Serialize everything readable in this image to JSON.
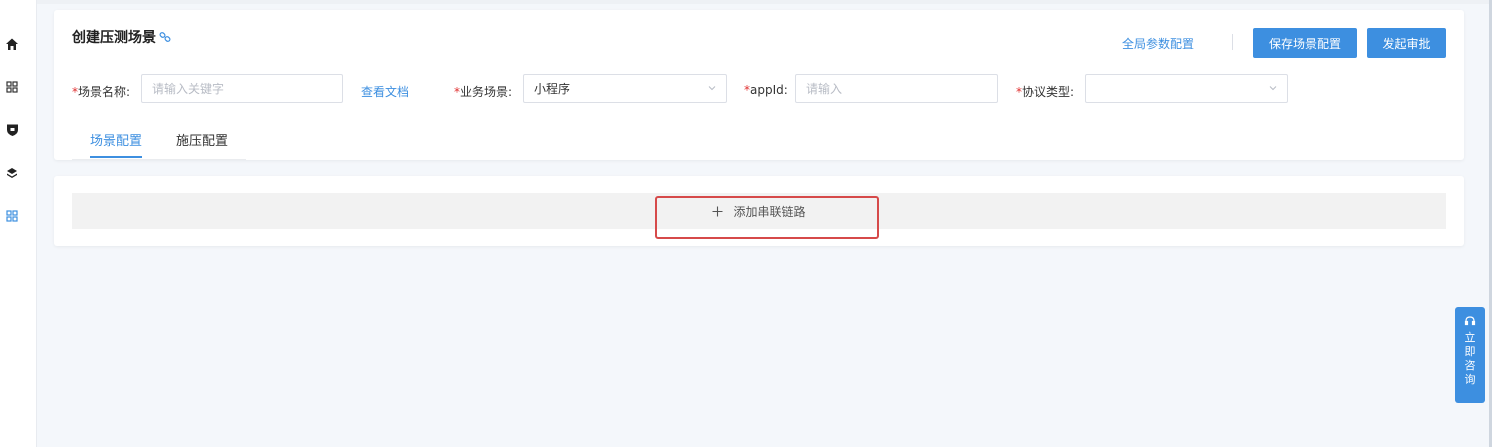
{
  "sidebar": {
    "icons": [
      "home-icon",
      "grid-icon",
      "shield-icon",
      "layers-icon",
      "apps-icon"
    ]
  },
  "header": {
    "title": "创建压测场景",
    "global_config": "全局参数配置",
    "save_button": "保存场景配置",
    "approve_button": "发起审批"
  },
  "form": {
    "scene_name": {
      "required": "*",
      "label": "场景名称:",
      "placeholder": "请输入关键字",
      "value": ""
    },
    "doc_link": "查看文档",
    "business_scene": {
      "required": "*",
      "label": "业务场景:",
      "value": "小程序"
    },
    "appid": {
      "required": "*",
      "label": "appId:",
      "placeholder": "请输入",
      "value": ""
    },
    "protocol": {
      "required": "*",
      "label": "协议类型:",
      "value": ""
    }
  },
  "tabs": [
    {
      "label": "场景配置",
      "active": true
    },
    {
      "label": "施压配置",
      "active": false
    }
  ],
  "chain": {
    "add_label": "添加串联链路"
  },
  "consult": {
    "label": "立即咨询"
  },
  "colors": {
    "primary": "#3d8fe0",
    "required": "#e03030",
    "highlight": "#d64a4a"
  }
}
